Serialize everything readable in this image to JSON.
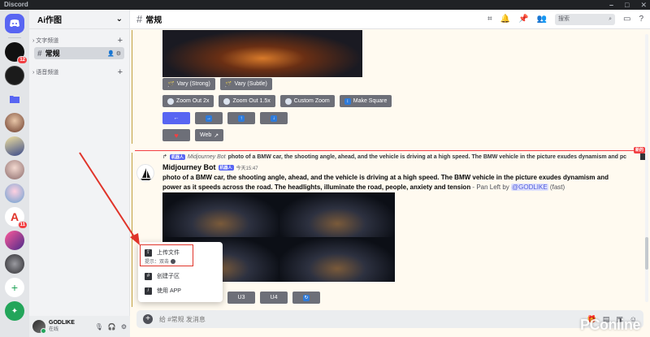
{
  "window": {
    "title": "Discord"
  },
  "rail": {
    "servers": [
      {
        "name": "server-1",
        "badge": "12"
      },
      {
        "name": "server-2",
        "badge": ""
      },
      {
        "name": "server-3",
        "badge": ""
      },
      {
        "name": "server-4",
        "badge": ""
      },
      {
        "name": "server-5",
        "badge": ""
      },
      {
        "name": "server-6",
        "badge": ""
      },
      {
        "name": "server-7",
        "badge": ""
      },
      {
        "name": "server-8",
        "badge": "11"
      },
      {
        "name": "server-9",
        "badge": ""
      },
      {
        "name": "server-10",
        "badge": ""
      }
    ]
  },
  "sidebar": {
    "guild_name": "Ai作图",
    "categories": [
      {
        "label": "文字频道"
      },
      {
        "label": "语音频道"
      }
    ],
    "channel": "常规",
    "user": {
      "name": "GODLIKE",
      "status": "在线"
    }
  },
  "header": {
    "channel": "常规",
    "search_placeholder": "搜索"
  },
  "buttons": {
    "row1": [
      "Vary (Strong)",
      "Vary (Subtle)"
    ],
    "row2": [
      "Zoom Out 2x",
      "Zoom Out 1.5x",
      "Custom Zoom",
      "Make Square"
    ],
    "row3": [
      "←",
      "→",
      "↑",
      "↓"
    ],
    "row4": [
      "",
      "Web"
    ],
    "row_bottom": [
      "U3",
      "U4",
      "↻"
    ]
  },
  "new_tag": "新的",
  "reply": {
    "tag": "机器人",
    "bot": "Midjourney Bot",
    "text": "photo of a BMW car, the shooting angle, ahead, and the vehicle is driving at a high speed. The BMW vehicle in the picture exudes dynamism and pc"
  },
  "message": {
    "author": "Midjourney Bot",
    "tag": "机器人",
    "time": "今天15:47",
    "prompt": "photo of a BMW car, the shooting angle, ahead, and the vehicle is driving at a high speed. The BMW vehicle in the picture exudes dynamism and power as it speeds across the road. The headlights, illuminate the road, people, anxiety and tension",
    "suffix": " - Pan Left by ",
    "mention": "@GODLIKE",
    "mode": " (fast)"
  },
  "popup": {
    "upload": "上传文件",
    "hint": "提示：双击",
    "thread": "创建子区",
    "app": "使用 APP"
  },
  "composer": {
    "placeholder": "给 #常规 发消息"
  },
  "watermark": "PConline",
  "colors": {
    "blurple": "#5865f2",
    "danger": "#f23f43",
    "annotation": "#e0342a"
  }
}
